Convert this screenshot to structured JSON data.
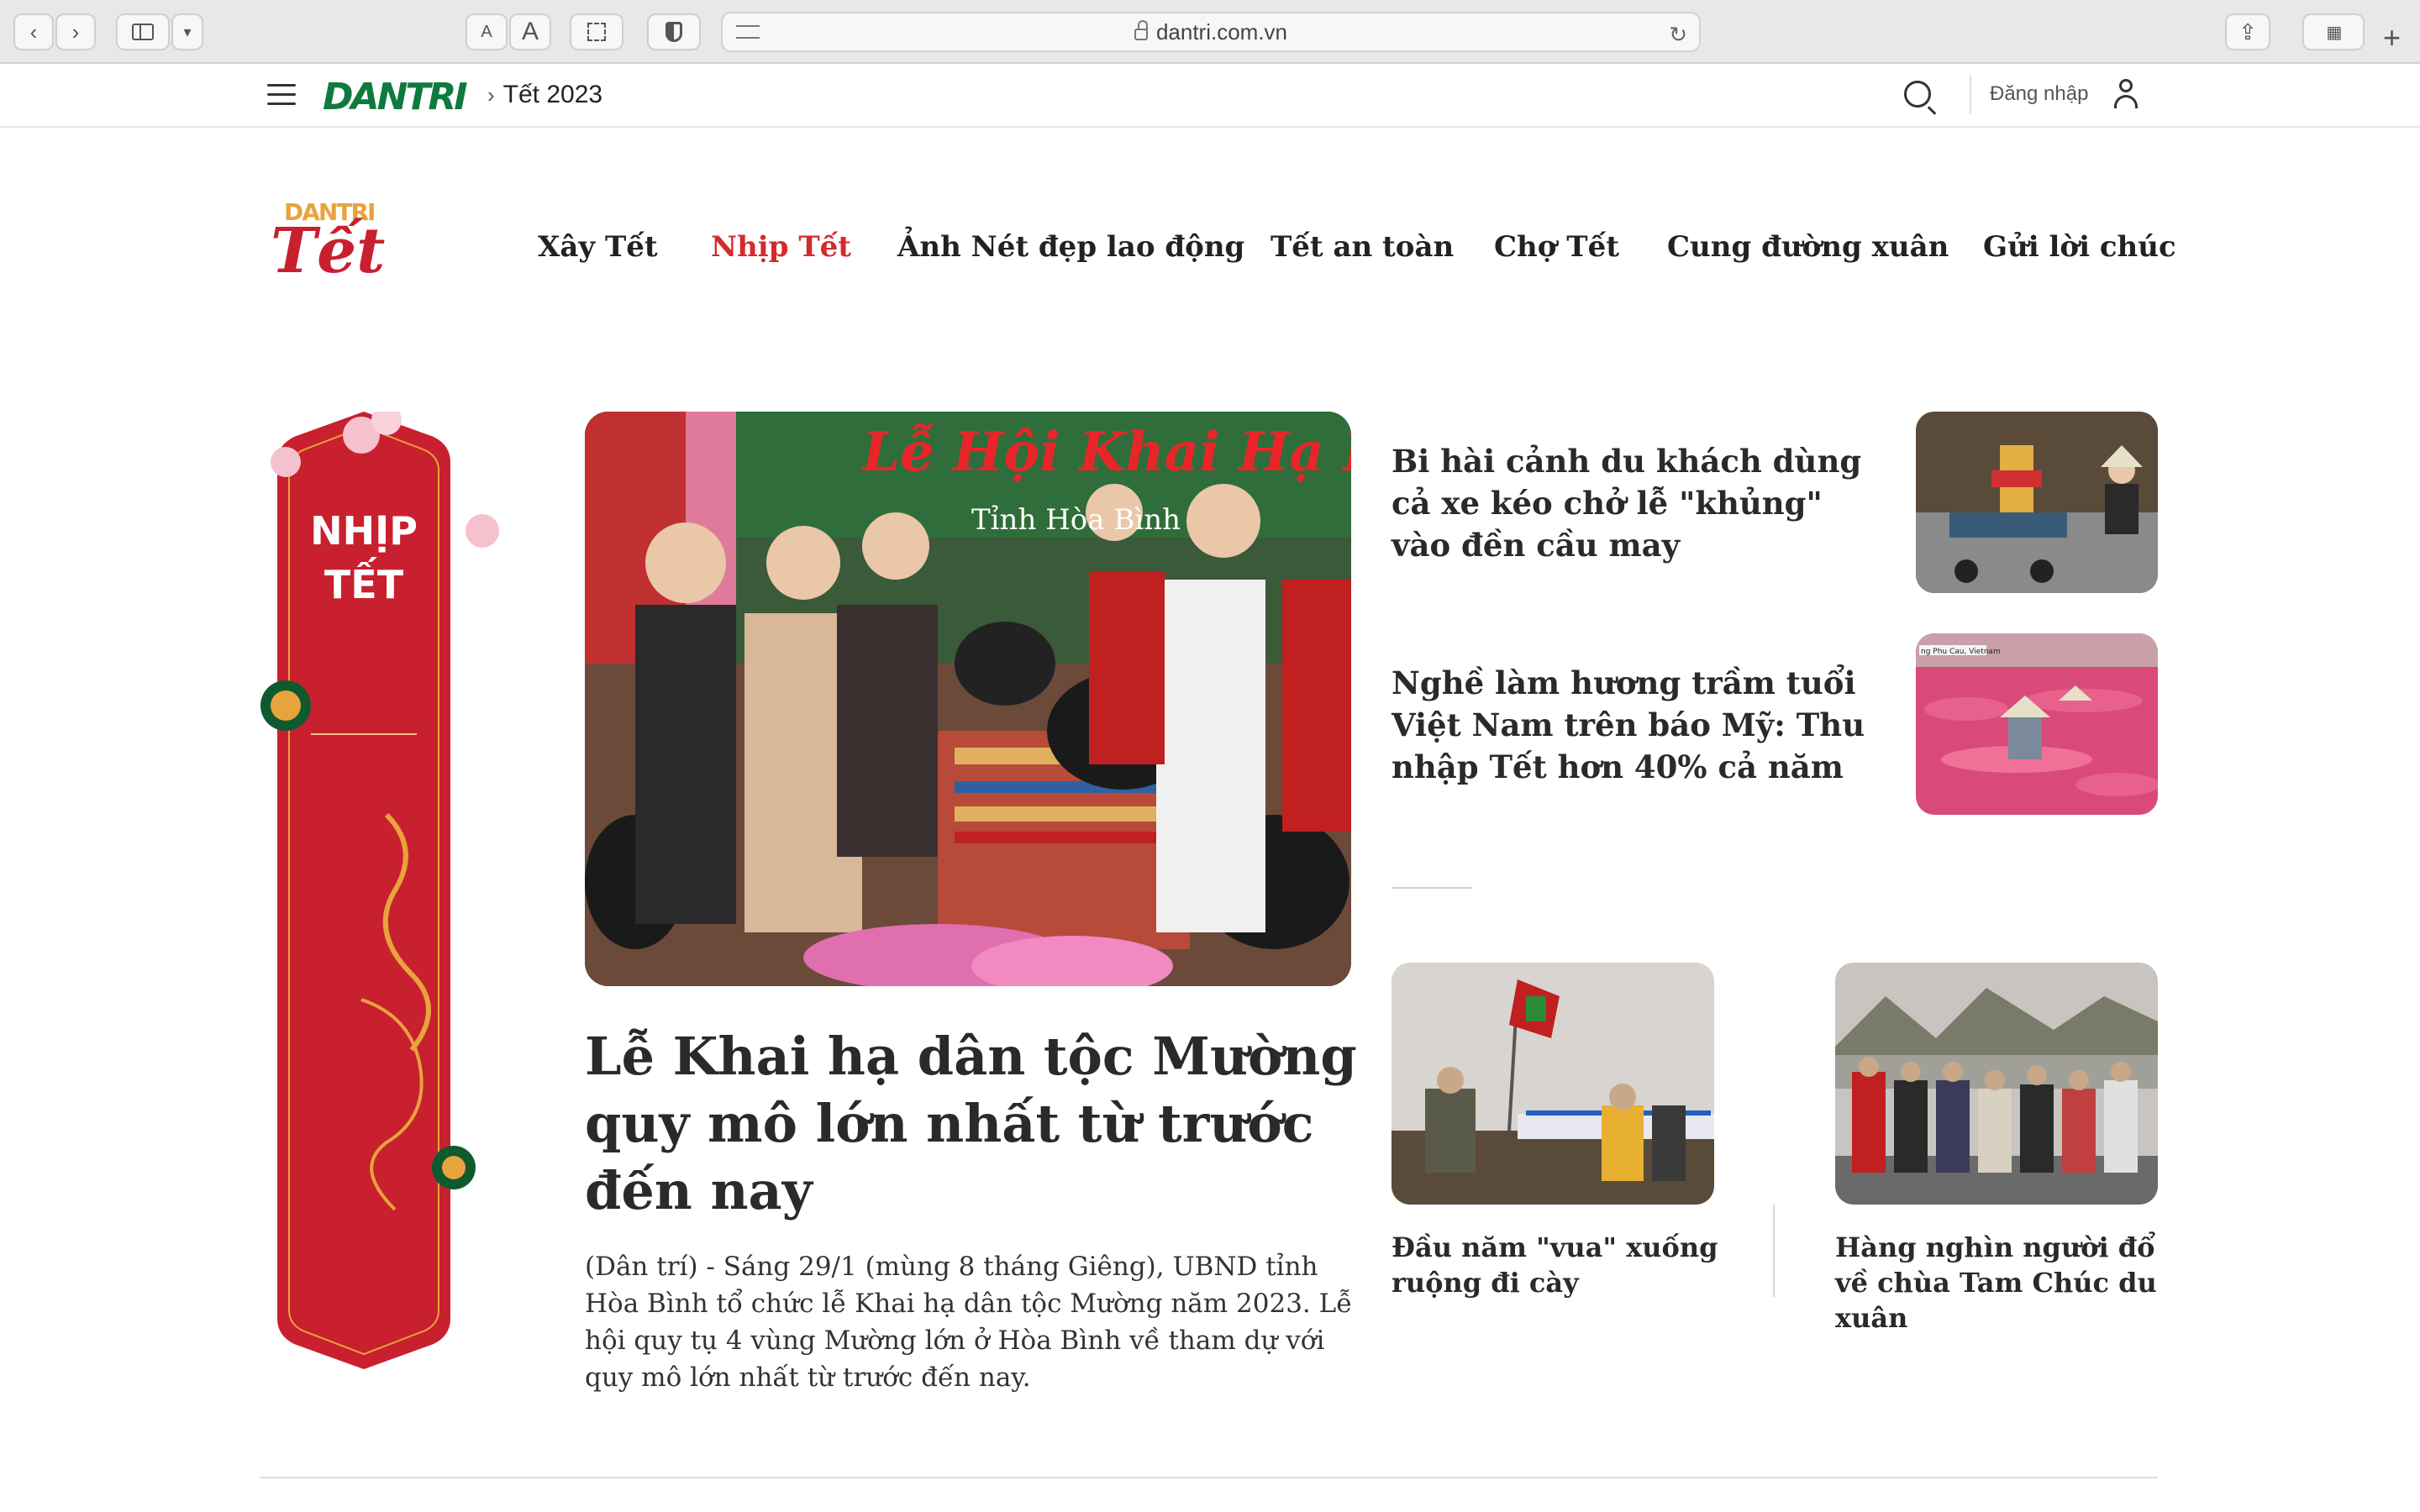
{
  "browser": {
    "url": "dantri.com.vn",
    "text_size_small": "A",
    "text_size_large": "A"
  },
  "site": {
    "logo": "DANTRI",
    "breadcrumb": "Tết 2023",
    "login_label": "Đăng nhập"
  },
  "tet_header": {
    "logo_small": "DANTRI",
    "logo_big": "Tết",
    "nav": [
      {
        "label": "Xây Tết",
        "active": false
      },
      {
        "label": "Nhịp Tết",
        "active": true
      },
      {
        "label": "Ảnh Nét đẹp lao động",
        "active": false
      },
      {
        "label": "Tết an toàn",
        "active": false
      },
      {
        "label": "Chợ Tết",
        "active": false
      },
      {
        "label": "Cung đường xuân",
        "active": false
      },
      {
        "label": "Gửi lời chúc",
        "active": false
      }
    ]
  },
  "banner": {
    "line1": "NHỊP",
    "line2": "TẾT"
  },
  "hero": {
    "image_caption": "Lễ Hội Khai Hạ Dân",
    "image_subcaption": "Tỉnh Hòa Bình",
    "title": "Lễ Khai hạ dân tộc Mường quy mô lớn nhất từ trước đến nay",
    "sapo": "(Dân trí) - Sáng 29/1 (mùng 8 tháng Giêng), UBND tỉnh Hòa Bình tổ chức lễ Khai hạ dân tộc Mường năm 2023. Lễ hội quy tụ 4 vùng Mường lớn ở Hòa Bình về tham dự với quy mô lớn nhất từ trước đến nay."
  },
  "side_articles": [
    {
      "title": "Bi hài cảnh du khách dùng cả xe kéo chở lễ \"khủng\" vào đền cầu may"
    },
    {
      "title": "Nghề làm hương trầm tuổi Việt Nam trên báo Mỹ: Thu nhập Tết hơn 40% cả năm",
      "thumb_label": "ng Phu Cau, Vietnam"
    }
  ],
  "bottom_articles": [
    {
      "title": "Đầu năm \"vua\" xuống ruộng đi cày"
    },
    {
      "title": "Hàng nghìn người đổ về chùa Tam Chúc du xuân"
    }
  ],
  "colors": {
    "brand_green": "#0e7a3e",
    "tet_red": "#c8202f",
    "active_nav": "#d42a2a"
  }
}
